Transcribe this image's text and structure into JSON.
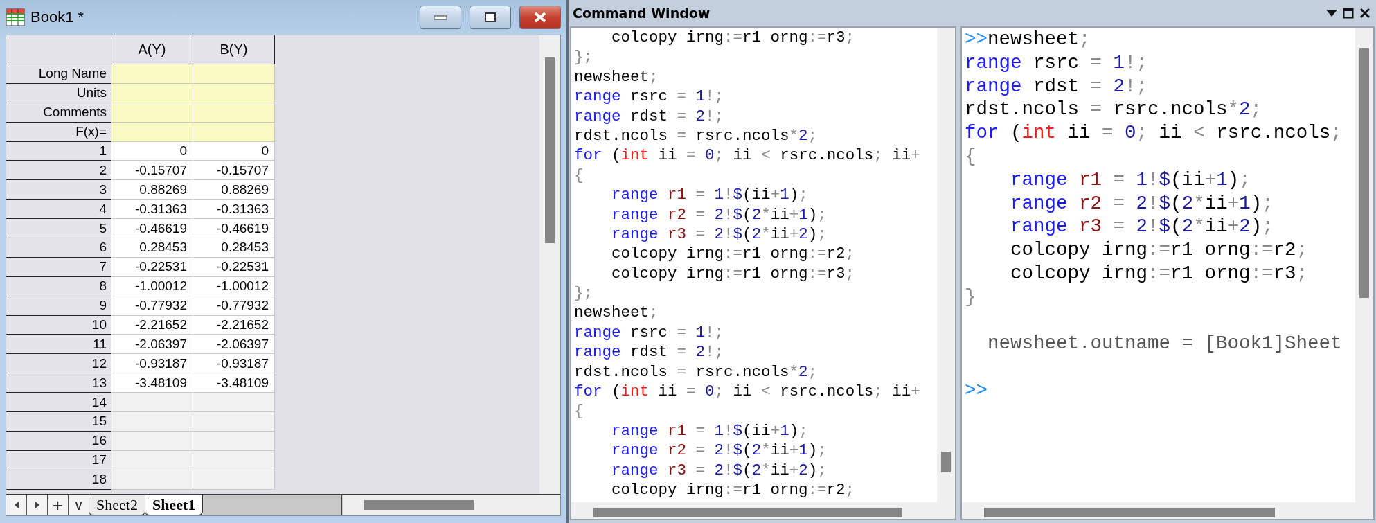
{
  "workbook": {
    "title": "Book1 *",
    "columns": [
      "A(Y)",
      "B(Y)"
    ],
    "meta_rows": [
      "Long Name",
      "Units",
      "Comments",
      "F(x)="
    ],
    "rows": [
      {
        "label": "1",
        "values": [
          "0",
          "0"
        ]
      },
      {
        "label": "2",
        "values": [
          "-0.15707",
          "-0.15707"
        ]
      },
      {
        "label": "3",
        "values": [
          "0.88269",
          "0.88269"
        ]
      },
      {
        "label": "4",
        "values": [
          "-0.31363",
          "-0.31363"
        ]
      },
      {
        "label": "5",
        "values": [
          "-0.46619",
          "-0.46619"
        ]
      },
      {
        "label": "6",
        "values": [
          "0.28453",
          "0.28453"
        ]
      },
      {
        "label": "7",
        "values": [
          "-0.22531",
          "-0.22531"
        ]
      },
      {
        "label": "8",
        "values": [
          "-1.00012",
          "-1.00012"
        ]
      },
      {
        "label": "9",
        "values": [
          "-0.77932",
          "-0.77932"
        ]
      },
      {
        "label": "10",
        "values": [
          "-2.21652",
          "-2.21652"
        ]
      },
      {
        "label": "11",
        "values": [
          "-2.06397",
          "-2.06397"
        ]
      },
      {
        "label": "12",
        "values": [
          "-0.93187",
          "-0.93187"
        ]
      },
      {
        "label": "13",
        "values": [
          "-3.48109",
          "-3.48109"
        ]
      },
      {
        "label": "14"
      },
      {
        "label": "15"
      },
      {
        "label": "16"
      },
      {
        "label": "17"
      },
      {
        "label": "18"
      }
    ],
    "nav_buttons": [
      {
        "kind": "arrow-left"
      },
      {
        "kind": "arrow-right"
      },
      {
        "kind": "text",
        "label": "+"
      },
      {
        "kind": "text",
        "label": "∨"
      }
    ],
    "sheet_tabs": [
      {
        "label": "Sheet2",
        "selected": false
      },
      {
        "label": "Sheet1",
        "selected": true
      }
    ]
  },
  "command_window": {
    "title": "Command Window",
    "panes": [
      {
        "lines": [
          {
            "kind": "code",
            "tokens": [
              {
                "text": "    colcopy irng",
                "kind": "plain"
              },
              {
                "text": ":=",
                "kind": "operator"
              },
              {
                "text": "r1 orng",
                "kind": "plain"
              },
              {
                "text": ":=",
                "kind": "operator"
              },
              {
                "text": "r3",
                "kind": "plain"
              },
              {
                "text": ";",
                "kind": "operator"
              }
            ]
          },
          {
            "kind": "code",
            "tokens": [
              {
                "text": "};",
                "kind": "operator"
              }
            ]
          },
          {
            "kind": "code",
            "tokens": [
              {
                "text": "newsheet",
                "kind": "plain"
              },
              {
                "text": ";",
                "kind": "operator"
              }
            ]
          },
          {
            "kind": "code",
            "tokens": [
              {
                "text": "range",
                "kind": "keyword"
              },
              {
                "text": " rsrc ",
                "kind": "plain"
              },
              {
                "text": "=",
                "kind": "operator"
              },
              {
                "text": " 1",
                "kind": "number"
              },
              {
                "text": "!;",
                "kind": "operator"
              }
            ]
          },
          {
            "kind": "code",
            "tokens": [
              {
                "text": "range",
                "kind": "keyword"
              },
              {
                "text": " rdst ",
                "kind": "plain"
              },
              {
                "text": "=",
                "kind": "operator"
              },
              {
                "text": " 2",
                "kind": "number"
              },
              {
                "text": "!;",
                "kind": "operator"
              }
            ]
          },
          {
            "kind": "code",
            "tokens": [
              {
                "text": "rdst.ncols ",
                "kind": "plain"
              },
              {
                "text": "=",
                "kind": "operator"
              },
              {
                "text": " rsrc.ncols",
                "kind": "plain"
              },
              {
                "text": "*",
                "kind": "operator"
              },
              {
                "text": "2",
                "kind": "number"
              },
              {
                "text": ";",
                "kind": "operator"
              }
            ]
          },
          {
            "kind": "code",
            "tokens": [
              {
                "text": "for",
                "kind": "keyword"
              },
              {
                "text": " (",
                "kind": "plain"
              },
              {
                "text": "int",
                "kind": "type"
              },
              {
                "text": " ii ",
                "kind": "plain"
              },
              {
                "text": "=",
                "kind": "operator"
              },
              {
                "text": " 0",
                "kind": "number"
              },
              {
                "text": ";",
                "kind": "operator"
              },
              {
                "text": " ii ",
                "kind": "plain"
              },
              {
                "text": "<",
                "kind": "operator"
              },
              {
                "text": " rsrc.ncols",
                "kind": "plain"
              },
              {
                "text": ";",
                "kind": "operator"
              },
              {
                "text": " ii",
                "kind": "plain"
              },
              {
                "text": "+",
                "kind": "operator"
              }
            ]
          },
          {
            "kind": "code",
            "tokens": [
              {
                "text": "{",
                "kind": "operator"
              }
            ]
          },
          {
            "kind": "code",
            "tokens": [
              {
                "text": "    range",
                "kind": "keyword"
              },
              {
                "text": " r1 ",
                "kind": "variable"
              },
              {
                "text": "=",
                "kind": "operator"
              },
              {
                "text": " 1",
                "kind": "number"
              },
              {
                "text": "!",
                "kind": "operator"
              },
              {
                "text": "$",
                "kind": "number"
              },
              {
                "text": "(ii",
                "kind": "plain"
              },
              {
                "text": "+",
                "kind": "operator"
              },
              {
                "text": "1",
                "kind": "number"
              },
              {
                "text": ")",
                "kind": "plain"
              },
              {
                "text": ";",
                "kind": "operator"
              }
            ]
          },
          {
            "kind": "code",
            "tokens": [
              {
                "text": "    range",
                "kind": "keyword"
              },
              {
                "text": " r2 ",
                "kind": "variable"
              },
              {
                "text": "=",
                "kind": "operator"
              },
              {
                "text": " 2",
                "kind": "number"
              },
              {
                "text": "!",
                "kind": "operator"
              },
              {
                "text": "$",
                "kind": "number"
              },
              {
                "text": "(",
                "kind": "plain"
              },
              {
                "text": "2",
                "kind": "number"
              },
              {
                "text": "*",
                "kind": "operator"
              },
              {
                "text": "ii",
                "kind": "plain"
              },
              {
                "text": "+",
                "kind": "operator"
              },
              {
                "text": "1",
                "kind": "number"
              },
              {
                "text": ")",
                "kind": "plain"
              },
              {
                "text": ";",
                "kind": "operator"
              }
            ]
          },
          {
            "kind": "code",
            "tokens": [
              {
                "text": "    range",
                "kind": "keyword"
              },
              {
                "text": " r3 ",
                "kind": "variable"
              },
              {
                "text": "=",
                "kind": "operator"
              },
              {
                "text": " 2",
                "kind": "number"
              },
              {
                "text": "!",
                "kind": "operator"
              },
              {
                "text": "$",
                "kind": "number"
              },
              {
                "text": "(",
                "kind": "plain"
              },
              {
                "text": "2",
                "kind": "number"
              },
              {
                "text": "*",
                "kind": "operator"
              },
              {
                "text": "ii",
                "kind": "plain"
              },
              {
                "text": "+",
                "kind": "operator"
              },
              {
                "text": "2",
                "kind": "number"
              },
              {
                "text": ")",
                "kind": "plain"
              },
              {
                "text": ";",
                "kind": "operator"
              }
            ]
          },
          {
            "kind": "code",
            "tokens": [
              {
                "text": "    colcopy irng",
                "kind": "plain"
              },
              {
                "text": ":=",
                "kind": "operator"
              },
              {
                "text": "r1 orng",
                "kind": "plain"
              },
              {
                "text": ":=",
                "kind": "operator"
              },
              {
                "text": "r2",
                "kind": "plain"
              },
              {
                "text": ";",
                "kind": "operator"
              }
            ]
          },
          {
            "kind": "code",
            "tokens": [
              {
                "text": "    colcopy irng",
                "kind": "plain"
              },
              {
                "text": ":=",
                "kind": "operator"
              },
              {
                "text": "r1 orng",
                "kind": "plain"
              },
              {
                "text": ":=",
                "kind": "operator"
              },
              {
                "text": "r3",
                "kind": "plain"
              },
              {
                "text": ";",
                "kind": "operator"
              }
            ]
          },
          {
            "kind": "code",
            "tokens": [
              {
                "text": "};",
                "kind": "operator"
              }
            ]
          },
          {
            "kind": "code",
            "tokens": [
              {
                "text": "newsheet",
                "kind": "plain"
              },
              {
                "text": ";",
                "kind": "operator"
              }
            ]
          },
          {
            "kind": "code",
            "tokens": [
              {
                "text": "range",
                "kind": "keyword"
              },
              {
                "text": " rsrc ",
                "kind": "plain"
              },
              {
                "text": "=",
                "kind": "operator"
              },
              {
                "text": " 1",
                "kind": "number"
              },
              {
                "text": "!;",
                "kind": "operator"
              }
            ]
          },
          {
            "kind": "code",
            "tokens": [
              {
                "text": "range",
                "kind": "keyword"
              },
              {
                "text": " rdst ",
                "kind": "plain"
              },
              {
                "text": "=",
                "kind": "operator"
              },
              {
                "text": " 2",
                "kind": "number"
              },
              {
                "text": "!;",
                "kind": "operator"
              }
            ]
          },
          {
            "kind": "code",
            "tokens": [
              {
                "text": "rdst.ncols ",
                "kind": "plain"
              },
              {
                "text": "=",
                "kind": "operator"
              },
              {
                "text": " rsrc.ncols",
                "kind": "plain"
              },
              {
                "text": "*",
                "kind": "operator"
              },
              {
                "text": "2",
                "kind": "number"
              },
              {
                "text": ";",
                "kind": "operator"
              }
            ]
          },
          {
            "kind": "code",
            "tokens": [
              {
                "text": "for",
                "kind": "keyword"
              },
              {
                "text": " (",
                "kind": "plain"
              },
              {
                "text": "int",
                "kind": "type"
              },
              {
                "text": " ii ",
                "kind": "plain"
              },
              {
                "text": "=",
                "kind": "operator"
              },
              {
                "text": " 0",
                "kind": "number"
              },
              {
                "text": ";",
                "kind": "operator"
              },
              {
                "text": " ii ",
                "kind": "plain"
              },
              {
                "text": "<",
                "kind": "operator"
              },
              {
                "text": " rsrc.ncols",
                "kind": "plain"
              },
              {
                "text": ";",
                "kind": "operator"
              },
              {
                "text": " ii",
                "kind": "plain"
              },
              {
                "text": "+",
                "kind": "operator"
              }
            ]
          },
          {
            "kind": "code",
            "tokens": [
              {
                "text": "{",
                "kind": "operator"
              }
            ]
          },
          {
            "kind": "code",
            "tokens": [
              {
                "text": "    range",
                "kind": "keyword"
              },
              {
                "text": " r1 ",
                "kind": "variable"
              },
              {
                "text": "=",
                "kind": "operator"
              },
              {
                "text": " 1",
                "kind": "number"
              },
              {
                "text": "!",
                "kind": "operator"
              },
              {
                "text": "$",
                "kind": "number"
              },
              {
                "text": "(ii",
                "kind": "plain"
              },
              {
                "text": "+",
                "kind": "operator"
              },
              {
                "text": "1",
                "kind": "number"
              },
              {
                "text": ")",
                "kind": "plain"
              },
              {
                "text": ";",
                "kind": "operator"
              }
            ]
          },
          {
            "kind": "code",
            "tokens": [
              {
                "text": "    range",
                "kind": "keyword"
              },
              {
                "text": " r2 ",
                "kind": "variable"
              },
              {
                "text": "=",
                "kind": "operator"
              },
              {
                "text": " 2",
                "kind": "number"
              },
              {
                "text": "!",
                "kind": "operator"
              },
              {
                "text": "$",
                "kind": "number"
              },
              {
                "text": "(",
                "kind": "plain"
              },
              {
                "text": "2",
                "kind": "number"
              },
              {
                "text": "*",
                "kind": "operator"
              },
              {
                "text": "ii",
                "kind": "plain"
              },
              {
                "text": "+",
                "kind": "operator"
              },
              {
                "text": "1",
                "kind": "number"
              },
              {
                "text": ")",
                "kind": "plain"
              },
              {
                "text": ";",
                "kind": "operator"
              }
            ]
          },
          {
            "kind": "code",
            "tokens": [
              {
                "text": "    range",
                "kind": "keyword"
              },
              {
                "text": " r3 ",
                "kind": "variable"
              },
              {
                "text": "=",
                "kind": "operator"
              },
              {
                "text": " 2",
                "kind": "number"
              },
              {
                "text": "!",
                "kind": "operator"
              },
              {
                "text": "$",
                "kind": "number"
              },
              {
                "text": "(",
                "kind": "plain"
              },
              {
                "text": "2",
                "kind": "number"
              },
              {
                "text": "*",
                "kind": "operator"
              },
              {
                "text": "ii",
                "kind": "plain"
              },
              {
                "text": "+",
                "kind": "operator"
              },
              {
                "text": "2",
                "kind": "number"
              },
              {
                "text": ")",
                "kind": "plain"
              },
              {
                "text": ";",
                "kind": "operator"
              }
            ]
          },
          {
            "kind": "code",
            "tokens": [
              {
                "text": "    colcopy irng",
                "kind": "plain"
              },
              {
                "text": ":=",
                "kind": "operator"
              },
              {
                "text": "r1 orng",
                "kind": "plain"
              },
              {
                "text": ":=",
                "kind": "operator"
              },
              {
                "text": "r2",
                "kind": "plain"
              },
              {
                "text": ";",
                "kind": "operator"
              }
            ]
          }
        ]
      },
      {
        "lines": [
          {
            "kind": "code",
            "tokens": [
              {
                "text": ">>",
                "kind": "prompt"
              },
              {
                "text": "newsheet",
                "kind": "plain"
              },
              {
                "text": ";",
                "kind": "operator"
              }
            ]
          },
          {
            "kind": "code",
            "tokens": [
              {
                "text": "range",
                "kind": "keyword"
              },
              {
                "text": " rsrc ",
                "kind": "plain"
              },
              {
                "text": "=",
                "kind": "operator"
              },
              {
                "text": " 1",
                "kind": "number"
              },
              {
                "text": "!;",
                "kind": "operator"
              }
            ]
          },
          {
            "kind": "code",
            "tokens": [
              {
                "text": "range",
                "kind": "keyword"
              },
              {
                "text": " rdst ",
                "kind": "plain"
              },
              {
                "text": "=",
                "kind": "operator"
              },
              {
                "text": " 2",
                "kind": "number"
              },
              {
                "text": "!;",
                "kind": "operator"
              }
            ]
          },
          {
            "kind": "code",
            "tokens": [
              {
                "text": "rdst.ncols ",
                "kind": "plain"
              },
              {
                "text": "=",
                "kind": "operator"
              },
              {
                "text": " rsrc.ncols",
                "kind": "plain"
              },
              {
                "text": "*",
                "kind": "operator"
              },
              {
                "text": "2",
                "kind": "number"
              },
              {
                "text": ";",
                "kind": "operator"
              }
            ]
          },
          {
            "kind": "code",
            "tokens": [
              {
                "text": "for",
                "kind": "keyword"
              },
              {
                "text": " (",
                "kind": "plain"
              },
              {
                "text": "int",
                "kind": "type"
              },
              {
                "text": " ii ",
                "kind": "plain"
              },
              {
                "text": "=",
                "kind": "operator"
              },
              {
                "text": " 0",
                "kind": "number"
              },
              {
                "text": ";",
                "kind": "operator"
              },
              {
                "text": " ii ",
                "kind": "plain"
              },
              {
                "text": "<",
                "kind": "operator"
              },
              {
                "text": " rsrc.ncols",
                "kind": "plain"
              },
              {
                "text": ";",
                "kind": "operator"
              }
            ]
          },
          {
            "kind": "code",
            "tokens": [
              {
                "text": "{",
                "kind": "operator"
              }
            ]
          },
          {
            "kind": "code",
            "tokens": [
              {
                "text": "    range",
                "kind": "keyword"
              },
              {
                "text": " r1 ",
                "kind": "variable"
              },
              {
                "text": "=",
                "kind": "operator"
              },
              {
                "text": " 1",
                "kind": "number"
              },
              {
                "text": "!",
                "kind": "operator"
              },
              {
                "text": "$",
                "kind": "number"
              },
              {
                "text": "(ii",
                "kind": "plain"
              },
              {
                "text": "+",
                "kind": "operator"
              },
              {
                "text": "1",
                "kind": "number"
              },
              {
                "text": ")",
                "kind": "plain"
              },
              {
                "text": ";",
                "kind": "operator"
              }
            ]
          },
          {
            "kind": "code",
            "tokens": [
              {
                "text": "    range",
                "kind": "keyword"
              },
              {
                "text": " r2 ",
                "kind": "variable"
              },
              {
                "text": "=",
                "kind": "operator"
              },
              {
                "text": " 2",
                "kind": "number"
              },
              {
                "text": "!",
                "kind": "operator"
              },
              {
                "text": "$",
                "kind": "number"
              },
              {
                "text": "(",
                "kind": "plain"
              },
              {
                "text": "2",
                "kind": "number"
              },
              {
                "text": "*",
                "kind": "operator"
              },
              {
                "text": "ii",
                "kind": "plain"
              },
              {
                "text": "+",
                "kind": "operator"
              },
              {
                "text": "1",
                "kind": "number"
              },
              {
                "text": ")",
                "kind": "plain"
              },
              {
                "text": ";",
                "kind": "operator"
              }
            ]
          },
          {
            "kind": "code",
            "tokens": [
              {
                "text": "    range",
                "kind": "keyword"
              },
              {
                "text": " r3 ",
                "kind": "variable"
              },
              {
                "text": "=",
                "kind": "operator"
              },
              {
                "text": " 2",
                "kind": "number"
              },
              {
                "text": "!",
                "kind": "operator"
              },
              {
                "text": "$",
                "kind": "number"
              },
              {
                "text": "(",
                "kind": "plain"
              },
              {
                "text": "2",
                "kind": "number"
              },
              {
                "text": "*",
                "kind": "operator"
              },
              {
                "text": "ii",
                "kind": "plain"
              },
              {
                "text": "+",
                "kind": "operator"
              },
              {
                "text": "2",
                "kind": "number"
              },
              {
                "text": ")",
                "kind": "plain"
              },
              {
                "text": ";",
                "kind": "operator"
              }
            ]
          },
          {
            "kind": "code",
            "tokens": [
              {
                "text": "    colcopy irng",
                "kind": "plain"
              },
              {
                "text": ":=",
                "kind": "operator"
              },
              {
                "text": "r1 orng",
                "kind": "plain"
              },
              {
                "text": ":=",
                "kind": "operator"
              },
              {
                "text": "r2",
                "kind": "plain"
              },
              {
                "text": ";",
                "kind": "operator"
              }
            ]
          },
          {
            "kind": "code",
            "tokens": [
              {
                "text": "    colcopy irng",
                "kind": "plain"
              },
              {
                "text": ":=",
                "kind": "operator"
              },
              {
                "text": "r1 orng",
                "kind": "plain"
              },
              {
                "text": ":=",
                "kind": "operator"
              },
              {
                "text": "r3",
                "kind": "plain"
              },
              {
                "text": ";",
                "kind": "operator"
              }
            ]
          },
          {
            "kind": "code",
            "tokens": [
              {
                "text": "}",
                "kind": "operator"
              }
            ]
          },
          {
            "kind": "blank"
          },
          {
            "kind": "code",
            "tokens": [
              {
                "text": "  newsheet.outname = [Book1]Sheet",
                "kind": "output"
              }
            ]
          },
          {
            "kind": "blank"
          },
          {
            "kind": "code",
            "tokens": [
              {
                "text": ">>",
                "kind": "prompt"
              }
            ]
          }
        ]
      }
    ]
  }
}
